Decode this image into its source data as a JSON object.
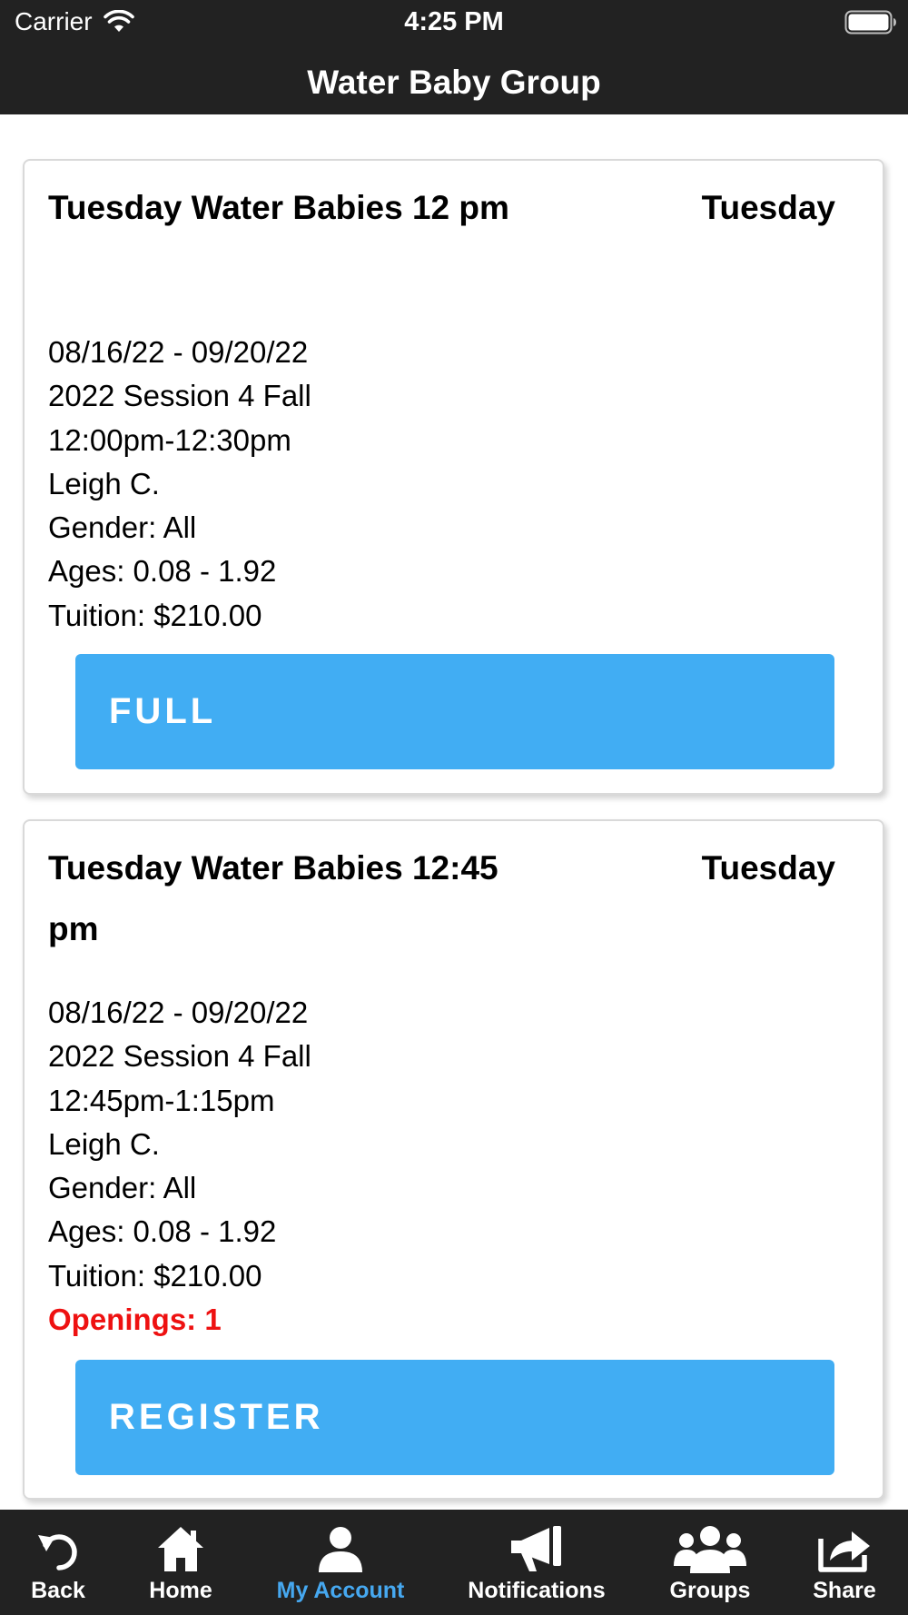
{
  "status_bar": {
    "carrier": "Carrier",
    "time": "4:25 PM"
  },
  "nav": {
    "title": "Water Baby Group"
  },
  "classes": [
    {
      "title": "Tuesday Water Babies 12 pm",
      "day": "Tuesday",
      "dates": "08/16/22 - 09/20/22",
      "session": "2022 Session 4 Fall",
      "time": "12:00pm-12:30pm",
      "instructor": "Leigh C.",
      "gender": "Gender: All",
      "ages": "Ages: 0.08 - 1.92",
      "tuition": "Tuition: $210.00",
      "button_label": "FULL"
    },
    {
      "title": "Tuesday Water Babies 12:45 pm",
      "day": "Tuesday",
      "dates": "08/16/22 - 09/20/22",
      "session": "2022 Session 4 Fall",
      "time": "12:45pm-1:15pm",
      "instructor": "Leigh C.",
      "gender": "Gender: All",
      "ages": "Ages: 0.08 - 1.92",
      "tuition": "Tuition: $210.00",
      "openings": "Openings: 1",
      "button_label": "REGISTER"
    }
  ],
  "colors": {
    "bar_bg": "#222222",
    "button_blue": "#41adf3",
    "active_tab": "#46a8f0",
    "openings_red": "#ee1111"
  },
  "tabs": [
    {
      "label": "Back",
      "icon": "undo-arrow-icon"
    },
    {
      "label": "Home",
      "icon": "home-icon"
    },
    {
      "label": "My Account",
      "icon": "person-icon",
      "active": true
    },
    {
      "label": "Notifications",
      "icon": "megaphone-icon"
    },
    {
      "label": "Groups",
      "icon": "group-icon"
    },
    {
      "label": "Share",
      "icon": "share-icon"
    }
  ]
}
